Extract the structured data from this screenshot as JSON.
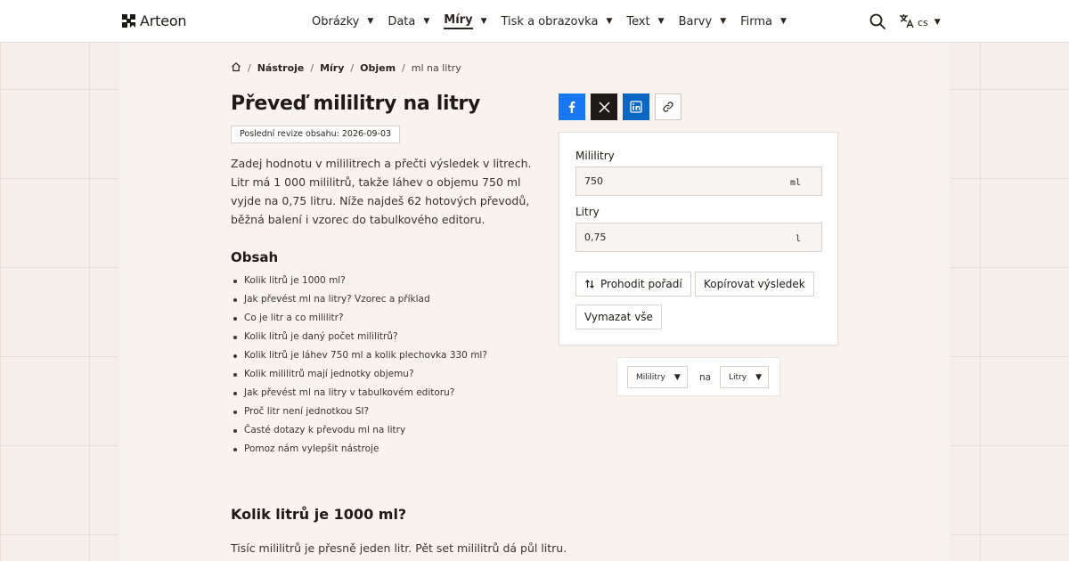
{
  "header": {
    "logo_text": "Arteon",
    "nav": [
      {
        "label": "Obrázky",
        "active": false
      },
      {
        "label": "Data",
        "active": false
      },
      {
        "label": "Míry",
        "active": true
      },
      {
        "label": "Tisk a obrazovka",
        "active": false
      },
      {
        "label": "Text",
        "active": false
      },
      {
        "label": "Barvy",
        "active": false
      },
      {
        "label": "Firma",
        "active": false
      }
    ],
    "lang": "cs"
  },
  "breadcrumb": {
    "items": [
      "Nástroje",
      "Míry",
      "Objem"
    ],
    "current": "ml na litry"
  },
  "main": {
    "title": "Převeď mililitry na litry",
    "revision": "Poslední revize obsahu: 2026-09-03",
    "intro": "Zadej hodnotu v mililitrech a přečti výsledek v litrech. Litr má 1 000 mililitrů, takže láhev o objemu 750 ml vyjde na 0,75 litru. Níže najdeš 62 hotových převodů, běžná balení i vzorec do tabulkového editoru.",
    "toc_title": "Obsah",
    "toc": [
      "Kolik litrů je 1000 ml?",
      "Jak převést ml na litry? Vzorec a příklad",
      "Co je litr a co mililitr?",
      "Kolik litrů je daný počet mililitrů?",
      "Kolik litrů je láhev 750 ml a kolik plechovka 330 ml?",
      "Kolik mililitrů mají jednotky objemu?",
      "Jak převést ml na litry v tabulkovém editoru?",
      "Proč litr není jednotkou SI?",
      "Časté dotazy k převodu ml na litry",
      "Pomoz nám vylepšit nástroje"
    ],
    "section_heading": "Kolik litrů je 1000 ml?",
    "section_text": "Tisíc mililitrů je přesně jeden litr. Pět set mililitrů dá půl litru."
  },
  "converter": {
    "from_label": "Mililitry",
    "from_value": "750",
    "from_unit": "ml",
    "to_label": "Litry",
    "to_value": "0,75",
    "to_unit": "l",
    "swap_label": "Prohodit pořadí",
    "copy_label": "Kopírovat výsledek",
    "clear_label": "Vymazat vše"
  },
  "unit_bar": {
    "from": "Mililitry",
    "connector": "na",
    "to": "Litry"
  },
  "colors": {
    "facebook": "#1877f2",
    "x": "#1e1a17",
    "linkedin": "#0a66c2",
    "background": "#f5ede7"
  }
}
